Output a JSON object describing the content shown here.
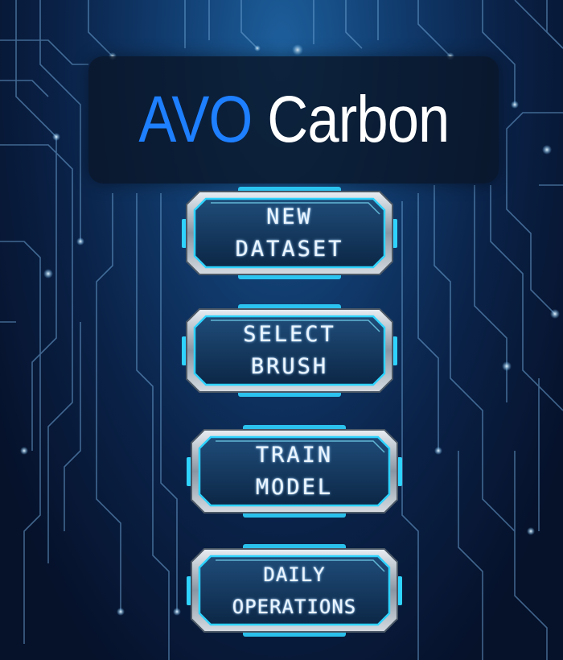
{
  "title": {
    "brand": "AVO",
    "rest": "Carbon"
  },
  "menu": {
    "items": [
      {
        "name": "new-dataset-button",
        "label": "NEW\nDATASET"
      },
      {
        "name": "select-brush-button",
        "label": "SELECT\nBRUSH"
      },
      {
        "name": "train-model-button",
        "label": "TRAIN\nMODEL"
      },
      {
        "name": "daily-operations-button",
        "label": "DAILY\nOPERATIONS"
      }
    ]
  },
  "colors": {
    "brand_blue": "#1e7fff",
    "title_white": "#ffffff",
    "accent_cyan": "#2fd3ff",
    "background_navy": "#07132b"
  }
}
